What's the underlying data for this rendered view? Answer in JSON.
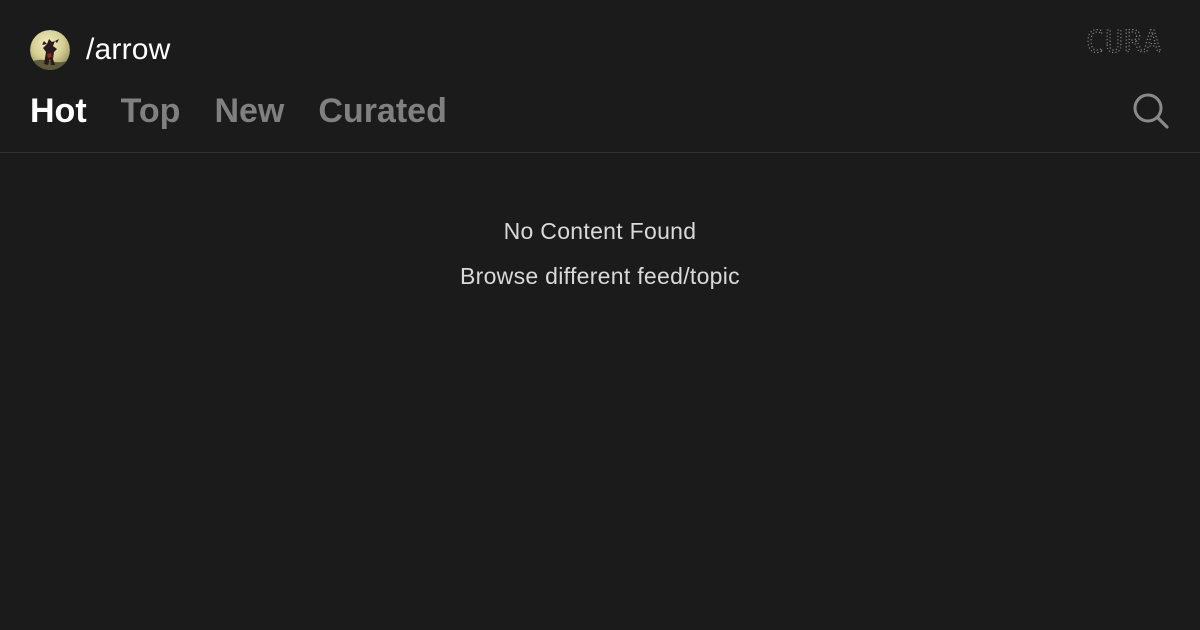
{
  "header": {
    "channel": {
      "name": "/arrow",
      "avatar_icon": "channel-avatar-icon"
    },
    "brand": {
      "text": "CURA",
      "color": "#8c8c8c"
    },
    "tabs": [
      {
        "label": "Hot",
        "active": true
      },
      {
        "label": "Top",
        "active": false
      },
      {
        "label": "New",
        "active": false
      },
      {
        "label": "Curated",
        "active": false
      }
    ],
    "search_icon": "search-icon"
  },
  "empty_state": {
    "title": "No Content Found",
    "subtitle": "Browse different feed/topic"
  },
  "colors": {
    "background": "#1b1b1b",
    "active_tab": "#ffffff",
    "inactive_tab": "#808080",
    "divider": "#323232",
    "muted_text": "#d9d9d9"
  }
}
